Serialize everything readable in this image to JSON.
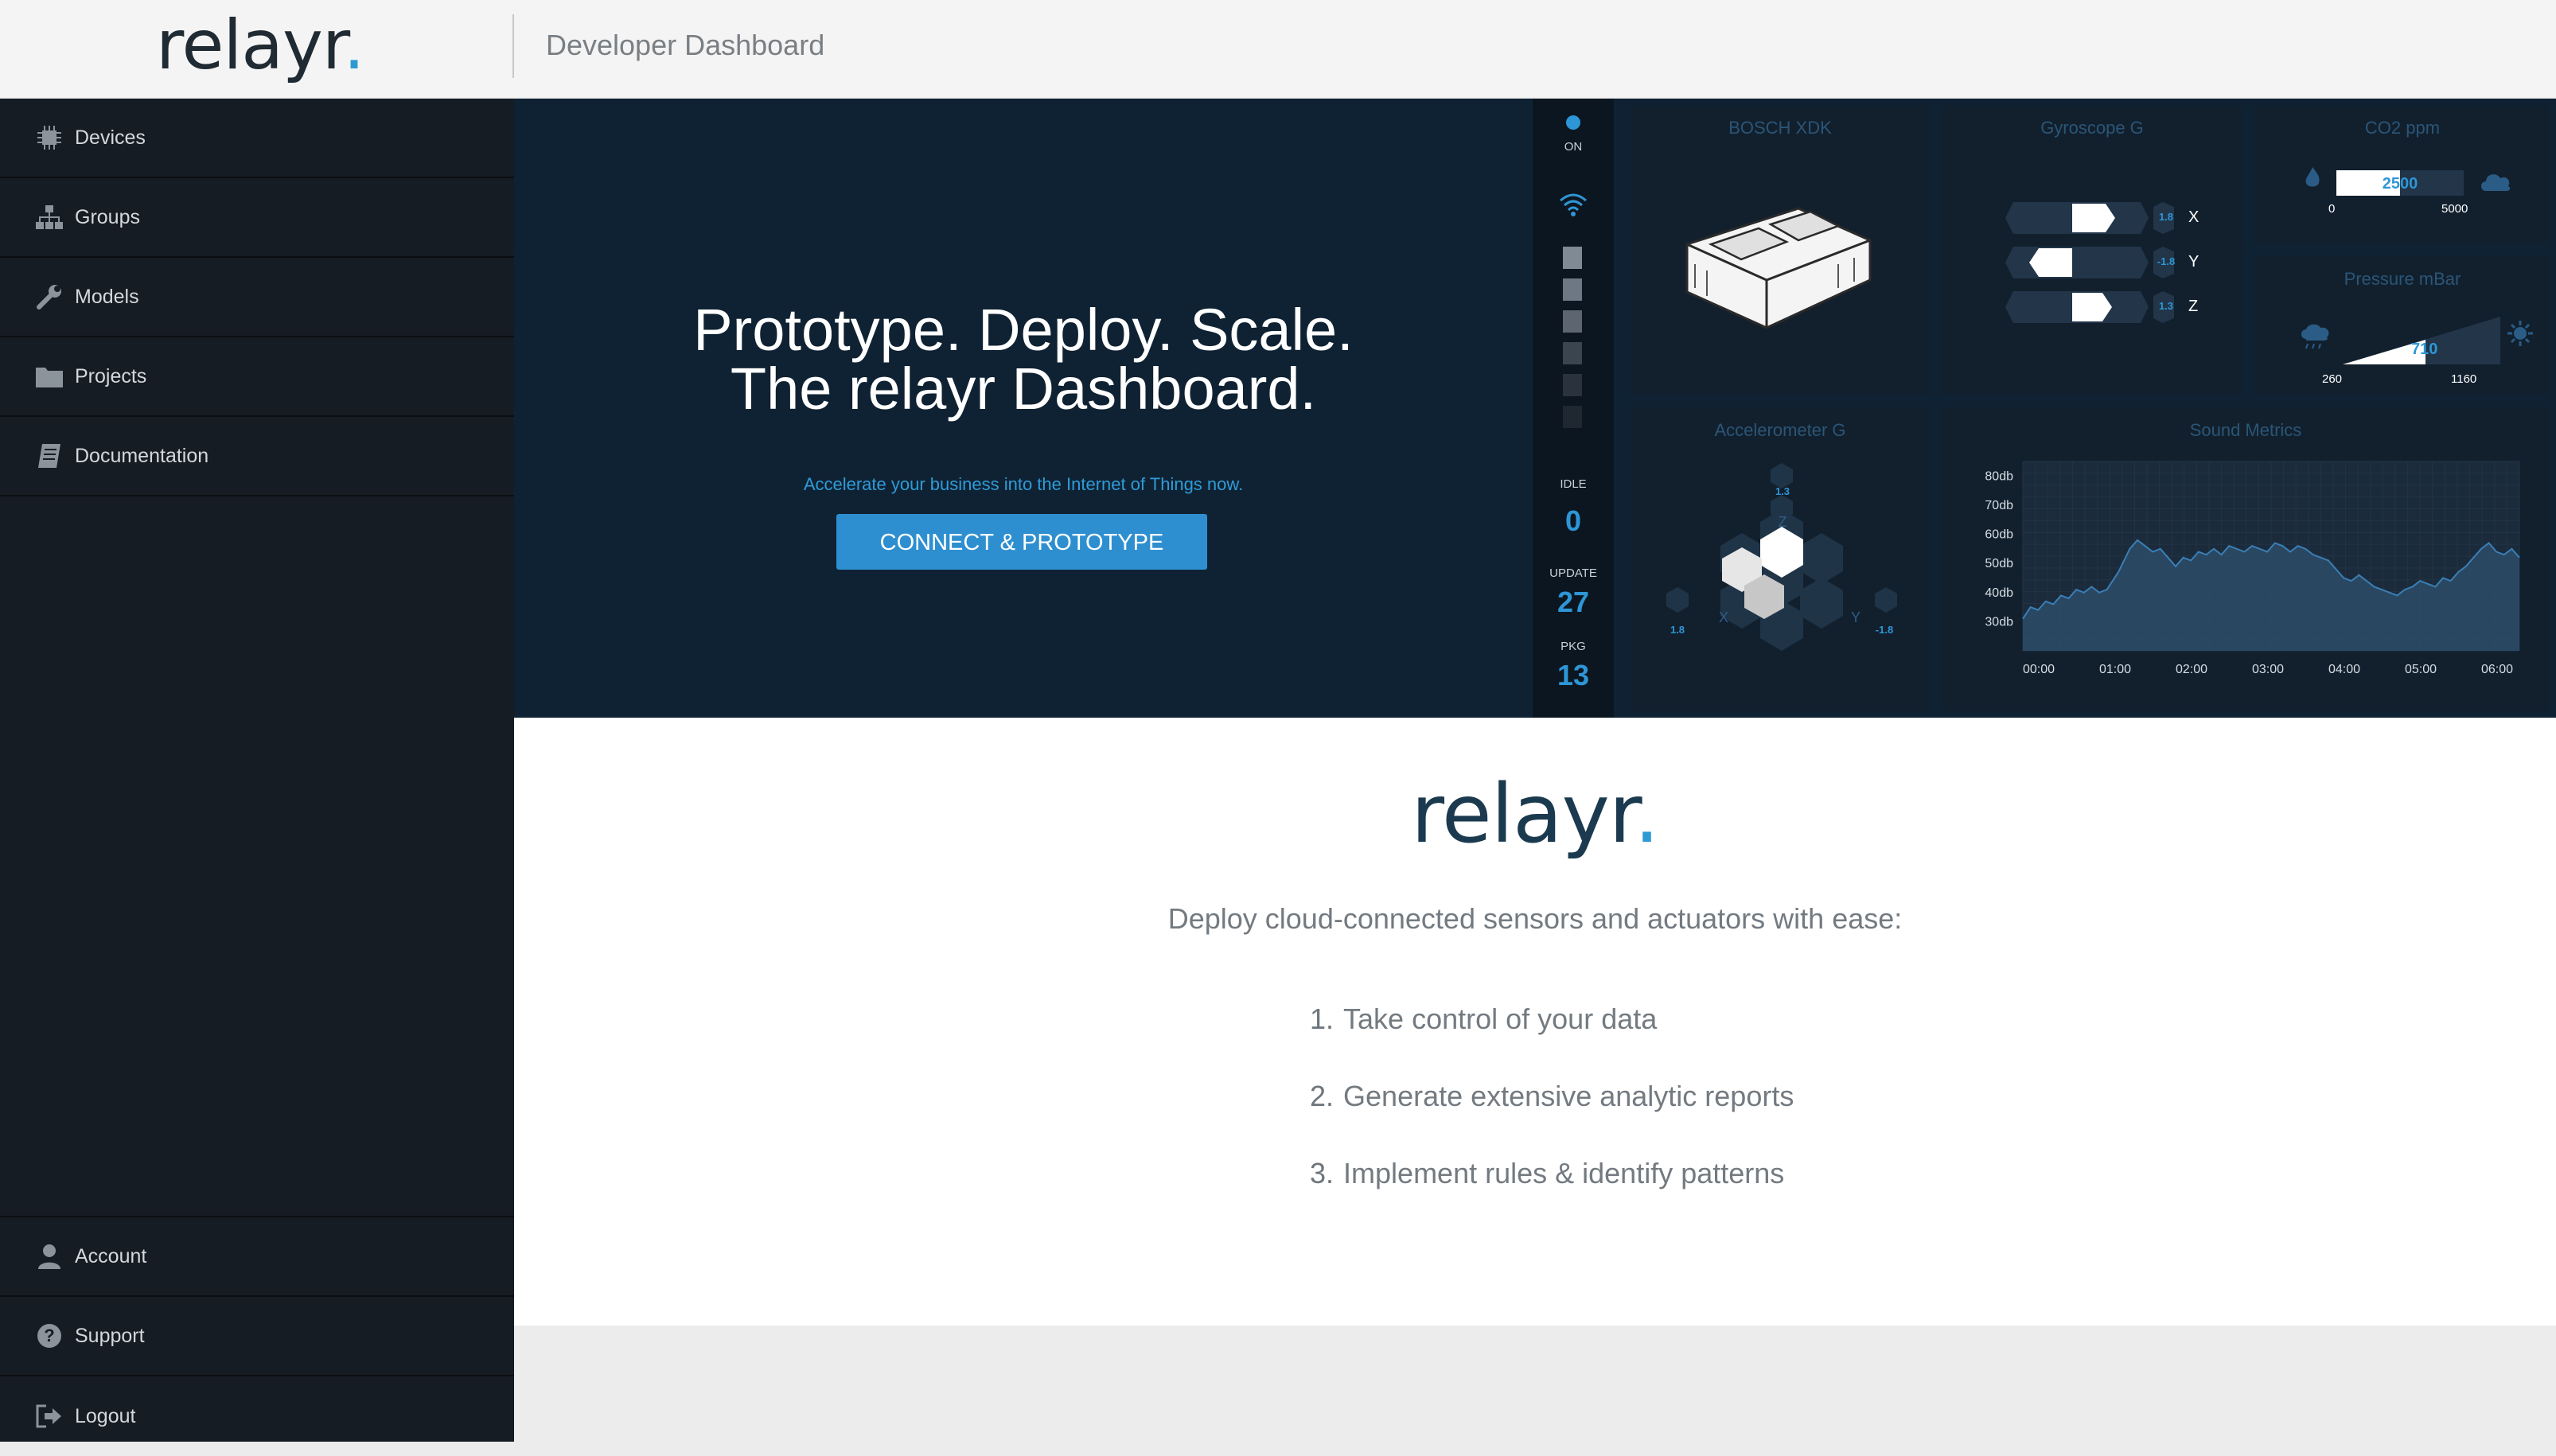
{
  "header": {
    "logo": "relayr",
    "logo_dot": ".",
    "title": "Developer Dashboard"
  },
  "sidebar": {
    "items": [
      {
        "label": "Devices",
        "icon": "chip-icon"
      },
      {
        "label": "Groups",
        "icon": "org-chart-icon"
      },
      {
        "label": "Models",
        "icon": "wrench-icon"
      },
      {
        "label": "Projects",
        "icon": "folder-icon"
      },
      {
        "label": "Documentation",
        "icon": "book-icon"
      }
    ],
    "bottom_items": [
      {
        "label": "Account",
        "icon": "user-icon"
      },
      {
        "label": "Support",
        "icon": "question-icon"
      },
      {
        "label": "Logout",
        "icon": "logout-icon"
      }
    ]
  },
  "hero": {
    "headline_1": "Prototype. Deploy. Scale.",
    "headline_2": "The relayr Dashboard.",
    "subtext": "Accelerate your business into the Internet of Things now.",
    "cta_label": "CONNECT & PROTOTYPE"
  },
  "status": {
    "on_label": "ON",
    "idle_label": "IDLE",
    "idle_value": "0",
    "update_label": "UPDATE",
    "update_value": "27",
    "pkg_label": "PKG",
    "pkg_value": "13",
    "signal_bars_lit": 3,
    "signal_bars_total": 6
  },
  "tiles": {
    "device": {
      "title": "BOSCH XDK"
    },
    "gyro": {
      "title": "Gyroscope G",
      "axes": [
        {
          "axis": "X",
          "value": "1.8"
        },
        {
          "axis": "Y",
          "value": "-1.8"
        },
        {
          "axis": "Z",
          "value": "1.3"
        }
      ]
    },
    "co2": {
      "title": "CO2 ppm",
      "value": "2500",
      "min": "0",
      "max": "5000"
    },
    "pressure": {
      "title": "Pressure mBar",
      "value": "710",
      "min": "260",
      "max": "1160"
    },
    "accel": {
      "title": "Accelerometer G",
      "z": "1.3",
      "x": "1.8",
      "y": "-1.8",
      "z_label": "Z",
      "x_label": "X",
      "y_label": "Y"
    },
    "sound": {
      "title": "Sound Metrics"
    }
  },
  "chart_data": {
    "type": "area",
    "title": "Sound Metrics",
    "xlabel": "",
    "ylabel": "",
    "x_ticks": [
      "00:00",
      "01:00",
      "02:00",
      "03:00",
      "04:00",
      "05:00",
      "06:00"
    ],
    "y_ticks": [
      "80db",
      "70db",
      "60db",
      "50db",
      "40db",
      "30db"
    ],
    "ylim": [
      20,
      85
    ],
    "xlim": [
      0,
      6.5
    ],
    "series": [
      {
        "x": [
          0,
          0.1,
          0.2,
          0.3,
          0.4,
          0.5,
          0.6,
          0.7,
          0.8,
          0.9,
          1.0,
          1.1,
          1.25,
          1.4,
          1.5,
          1.6,
          1.7,
          1.8,
          1.9,
          2.0,
          2.1,
          2.2,
          2.3,
          2.4,
          2.5,
          2.6,
          2.7,
          2.8,
          2.9,
          3.0,
          3.1,
          3.2,
          3.3,
          3.4,
          3.5,
          3.6,
          3.7,
          3.8,
          3.9,
          4.0,
          4.1,
          4.2,
          4.3,
          4.4,
          4.5,
          4.6,
          4.7,
          4.8,
          4.9,
          5.0,
          5.1,
          5.2,
          5.3,
          5.4,
          5.5,
          5.6,
          5.7,
          5.8,
          5.9,
          6.0,
          6.1,
          6.2,
          6.3,
          6.4,
          6.5
        ],
        "values": [
          31,
          35,
          34,
          37,
          36,
          39,
          38,
          41,
          40,
          42,
          40,
          41,
          47,
          55,
          58,
          56,
          54,
          55,
          52,
          49,
          52,
          51,
          54,
          53,
          55,
          53,
          56,
          55,
          54,
          56,
          55,
          54,
          57,
          56,
          54,
          56,
          55,
          53,
          52,
          51,
          48,
          45,
          44,
          46,
          44,
          42,
          41,
          40,
          39,
          41,
          42,
          44,
          43,
          42,
          45,
          44,
          47,
          49,
          52,
          55,
          57,
          54,
          53,
          55,
          52
        ]
      }
    ]
  },
  "content": {
    "logo": "relayr",
    "logo_dot": ".",
    "tagline": "Deploy cloud-connected sensors and actuators with ease:",
    "features": [
      {
        "num": "1.",
        "text": "Take control of your data"
      },
      {
        "num": "2.",
        "text": "Generate extensive analytic reports"
      },
      {
        "num": "3.",
        "text": "Implement rules & identify patterns"
      }
    ]
  },
  "colors": {
    "accent": "#2d9ad4",
    "sidebar_bg": "#161c23",
    "hero_bg": "#0f2233",
    "tile_bg": "#12202e"
  }
}
